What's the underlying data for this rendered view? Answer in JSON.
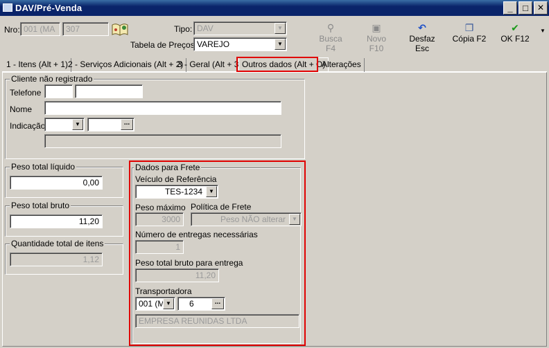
{
  "window": {
    "title": "DAV/Pré-Venda"
  },
  "header": {
    "nro_label": "Nro:",
    "nro_code": "001 (MA",
    "nro_number": "307",
    "tipo_label": "Tipo:",
    "tipo_value": "DAV",
    "tabela_label": "Tabela de Preços:",
    "tabela_value": "VAREJO"
  },
  "toolbar": {
    "busca": "Busca F4",
    "novo": "Novo F10",
    "desfaz": "Desfaz Esc",
    "copia": "Cópia F2",
    "ok": "OK F12"
  },
  "tabs": [
    {
      "label": "1 - Itens (Alt + 1)"
    },
    {
      "label": "2 - Serviços Adicionais (Alt + 2)"
    },
    {
      "label": "3 - Geral (Alt + 3)"
    },
    {
      "label": "Outros dados (Alt + O)"
    },
    {
      "label": "Alterações"
    }
  ],
  "cliente": {
    "group_label": "Cliente não registrado",
    "telefone_label": "Telefone",
    "nome_label": "Nome",
    "indicacao_label": "Indicação"
  },
  "pesos": {
    "liquido_label": "Peso total líquido",
    "liquido_value": "0,00",
    "bruto_label": "Peso total bruto",
    "bruto_value": "11,20",
    "qtd_label": "Quantidade total de itens",
    "qtd_value": "1,12"
  },
  "frete": {
    "group_label": "Dados para Frete",
    "veiculo_label": "Veículo de Referência",
    "veiculo_value": "TES-1234",
    "peso_max_label": "Peso máximo",
    "peso_max_value": "3000",
    "politica_label": "Política de Frete",
    "politica_value": "Peso NÃO alterar",
    "entregas_label": "Número de entregas necessárias",
    "entregas_value": "1",
    "peso_entrega_label": "Peso total bruto para entrega",
    "peso_entrega_value": "11,20",
    "transportadora_label": "Transportadora",
    "transportadora_code": "001 (MA",
    "transportadora_num": "6",
    "transportadora_nome": "EMPRESA REUNIDAS LTDA"
  },
  "colors": {
    "title_bar": "#0a246a",
    "highlight_red": "#e00000",
    "window_bg": "#d4d0c8",
    "desfaz_icon": "#1e50c8",
    "ok_icon": "#1a9a1a"
  },
  "icons": [
    "app-icon",
    "book-icon",
    "search-icon",
    "new-doc-icon",
    "undo-icon",
    "copy-icon",
    "check-icon",
    "minimize-icon",
    "maximize-icon",
    "close-icon"
  ]
}
